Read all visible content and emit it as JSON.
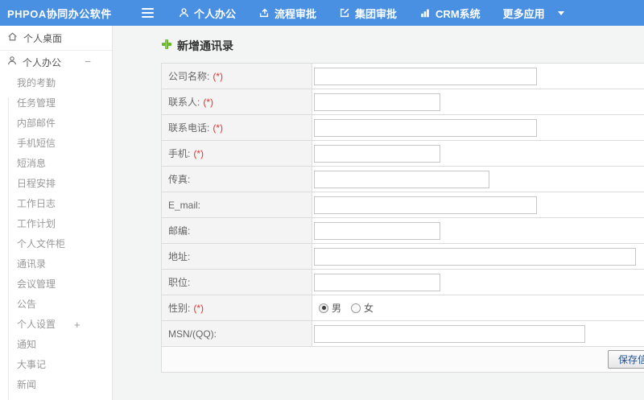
{
  "colors": {
    "topbar_blue": "#4a90e2",
    "required_red": "#e53333",
    "plus_green": "#6ab82e"
  },
  "topbar": {
    "logo": "PHPOA协同办公软件",
    "menu": [
      {
        "label": "个人办公",
        "icon": "person-icon"
      },
      {
        "label": "流程审批",
        "icon": "approval-flow-icon"
      },
      {
        "label": "集团审批",
        "icon": "edit-square-icon"
      },
      {
        "label": "CRM系统",
        "icon": "bar-chart-icon"
      },
      {
        "label": "更多应用",
        "icon": "caret-down-icon"
      }
    ]
  },
  "sidebar": {
    "desktop_label": "个人桌面",
    "group_label": "个人办公",
    "group_toggle": "−",
    "items": [
      {
        "label": "我的考勤",
        "toggle": ""
      },
      {
        "label": "任务管理",
        "toggle": ""
      },
      {
        "label": "内部邮件",
        "toggle": ""
      },
      {
        "label": "手机短信",
        "toggle": ""
      },
      {
        "label": "短消息",
        "toggle": ""
      },
      {
        "label": "日程安排",
        "toggle": ""
      },
      {
        "label": "工作日志",
        "toggle": ""
      },
      {
        "label": "工作计划",
        "toggle": ""
      },
      {
        "label": "个人文件柜",
        "toggle": ""
      },
      {
        "label": "通讯录",
        "toggle": ""
      },
      {
        "label": "会议管理",
        "toggle": ""
      },
      {
        "label": "公告",
        "toggle": ""
      },
      {
        "label": "个人设置",
        "toggle": "+"
      },
      {
        "label": "通知",
        "toggle": ""
      },
      {
        "label": "大事记",
        "toggle": ""
      },
      {
        "label": "新闻",
        "toggle": ""
      }
    ]
  },
  "main": {
    "title": "新增通讯录",
    "form": {
      "rows": [
        {
          "label": "公司名称:",
          "required": "(*)"
        },
        {
          "label": "联系人:",
          "required": "(*)"
        },
        {
          "label": "联系电话:",
          "required": "(*)"
        },
        {
          "label": "手机:",
          "required": "(*)"
        },
        {
          "label": "传真:",
          "required": ""
        },
        {
          "label": "E_mail:",
          "required": ""
        },
        {
          "label": "邮编:",
          "required": ""
        },
        {
          "label": "地址:",
          "required": ""
        },
        {
          "label": "职位:",
          "required": ""
        },
        {
          "label": "性别:",
          "required": "(*)"
        },
        {
          "label": "MSN/(QQ):",
          "required": ""
        }
      ],
      "gender_options": [
        {
          "label": "男",
          "checked": true
        },
        {
          "label": "女",
          "checked": false
        }
      ],
      "save_button": "保存信息"
    }
  }
}
